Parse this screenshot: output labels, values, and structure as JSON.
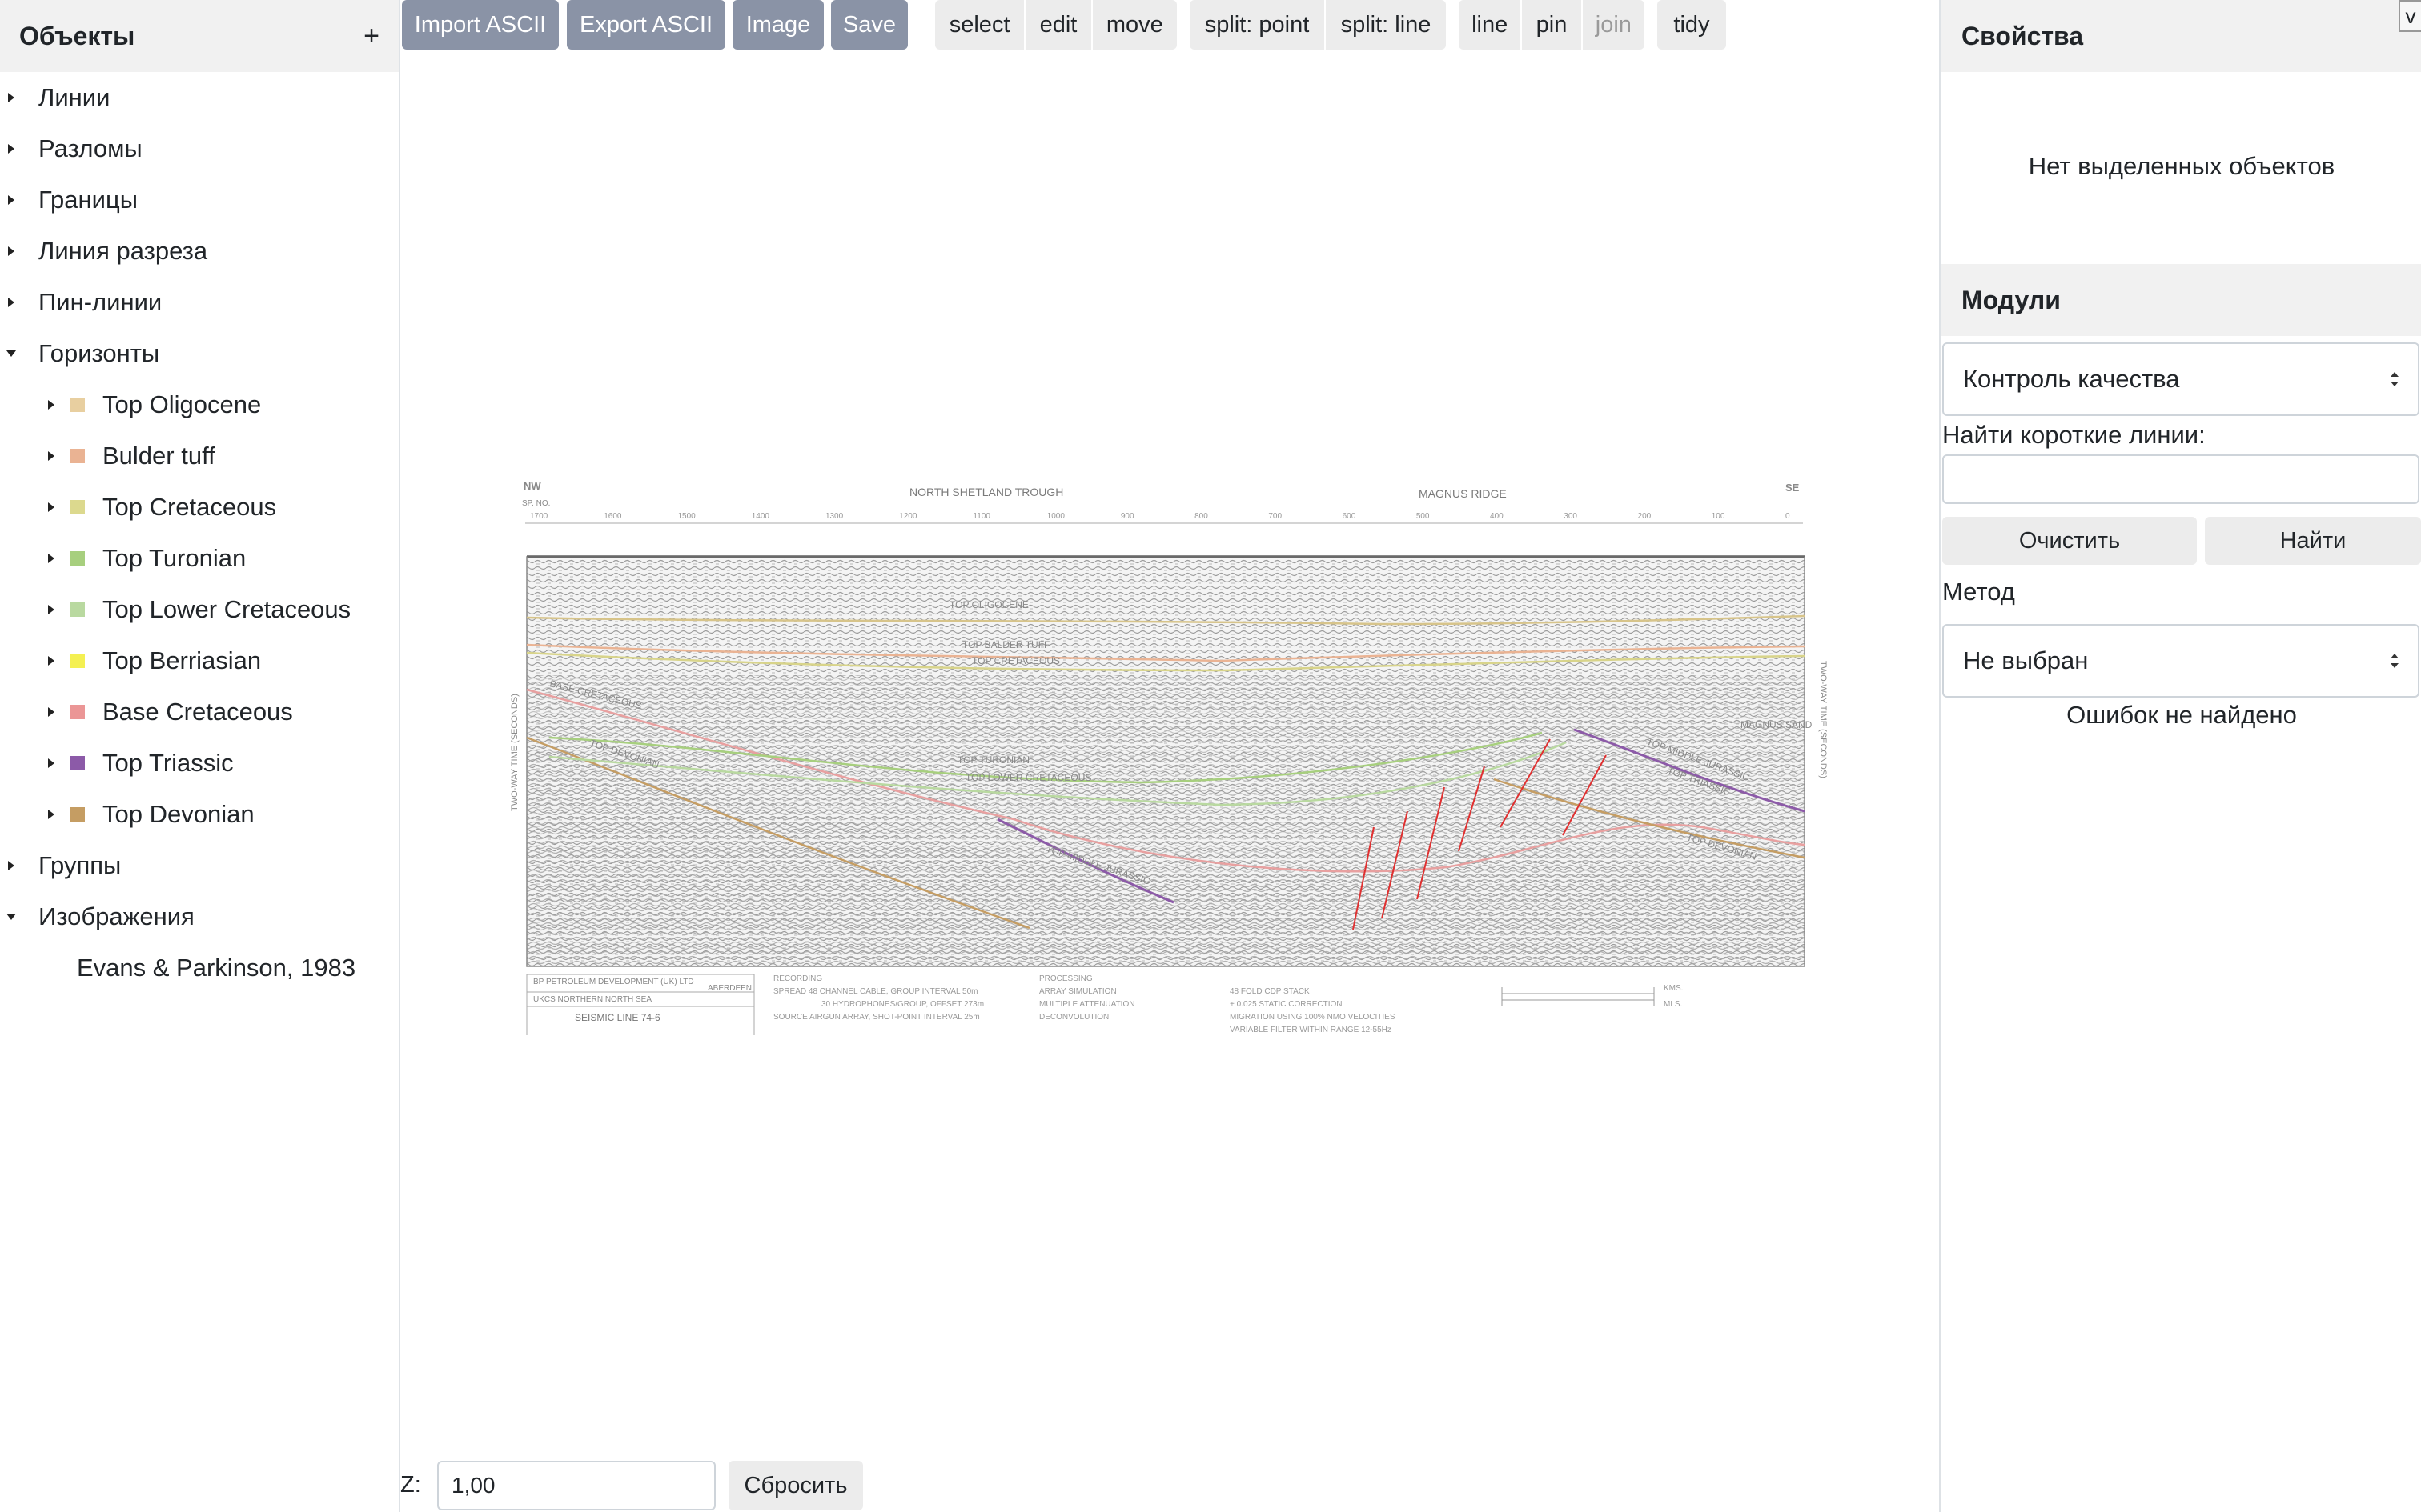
{
  "left_panel": {
    "title": "Объекты",
    "add_label": "+",
    "items": [
      {
        "label": "Линии"
      },
      {
        "label": "Разломы"
      },
      {
        "label": "Границы"
      },
      {
        "label": "Линия разреза"
      },
      {
        "label": "Пин-линии"
      },
      {
        "label": "Горизонты"
      },
      {
        "label": "Группы"
      },
      {
        "label": "Изображения"
      }
    ],
    "horizons": [
      {
        "label": "Top Oligocene",
        "color": "#e8cfa0"
      },
      {
        "label": "Bulder tuff",
        "color": "#eab393"
      },
      {
        "label": "Top Cretaceous",
        "color": "#dcd98e"
      },
      {
        "label": "Top Turonian",
        "color": "#a7cf7e"
      },
      {
        "label": "Top Lower Cretaceous",
        "color": "#b9d9a0"
      },
      {
        "label": "Top Berriasian",
        "color": "#f4f052"
      },
      {
        "label": "Base Cretaceous",
        "color": "#eb9696"
      },
      {
        "label": "Top Triassic",
        "color": "#8c5aa8"
      },
      {
        "label": "Top Devonian",
        "color": "#c59d63"
      }
    ],
    "images": [
      {
        "label": "Evans & Parkinson, 1983"
      }
    ]
  },
  "toolbar": {
    "import_label": "Import ASCII",
    "export_label": "Export ASCII",
    "image_label": "Image",
    "save_label": "Save",
    "mode_group": [
      "select",
      "edit",
      "move"
    ],
    "split_group": [
      "split: point",
      "split: line"
    ],
    "draw_group": [
      "line",
      "pin",
      "join"
    ],
    "tidy_label": "tidy"
  },
  "seismic": {
    "nw": "NW",
    "se": "SE",
    "sp_no": "SP. NO.",
    "trough": "NORTH SHETLAND  TROUGH",
    "ridge": "MAGNUS   RIDGE",
    "sp_ticks": [
      "1700",
      "1600",
      "1500",
      "1400",
      "1300",
      "1200",
      "1100",
      "1000",
      "900",
      "800",
      "700",
      "600",
      "500",
      "400",
      "300",
      "200",
      "100",
      "0"
    ],
    "time_label_left": "TWO-WAY TIME (SECONDS)",
    "time_label_right": "TWO-WAY TIME (SECONDS)",
    "horizon_labels": [
      "TOP OLIGOCENE",
      "TOP BALDER TUFF",
      "TOP CRETACEOUS",
      "BASE CRETACEOUS",
      "TOP DEVONIAN",
      "TOP TURONIAN",
      "TOP LOWER CRETACEOUS",
      "TOP MIDDLE JURASSIC",
      "MAGNUS SAND",
      "TOP MIDDLE JURASSIC",
      "TOP TRIASSIC",
      "TOP DEVONIAN"
    ],
    "company_1": "BP PETROLEUM DEVELOPMENT (UK) LTD",
    "company_2": "ABERDEEN",
    "ukcs": "UKCS   NORTHERN  NORTH  SEA",
    "line_name": "SEISMIC  LINE  74-6",
    "recording": "RECORDING",
    "spread": "SPREAD  48 CHANNEL CABLE, GROUP INTERVAL 50m",
    "hydro": "30 HYDROPHONES/GROUP, OFFSET 273m",
    "source": "SOURCE  AIRGUN ARRAY, SHOT-POINT INTERVAL 25m",
    "processing": "PROCESSING",
    "array_sim": "ARRAY SIMULATION",
    "mult_att": "MULTIPLE  ATTENUATION",
    "decon": "DECONVOLUTION",
    "cdp": "48 FOLD CDP STACK",
    "static": "+ 0.025  STATIC CORRECTION",
    "migration": "MIGRATION USING 100% NMO VELOCITIES",
    "filter": "VARIABLE FILTER WITHIN RANGE 12-55Hz",
    "kms": "KMS.",
    "mls": "MLS."
  },
  "bottom": {
    "z_label": "Z:",
    "z_value": "1,00",
    "reset_label": "Сбросить"
  },
  "right_panel": {
    "collapse_label": "v",
    "properties_title": "Свойства",
    "no_selection": "Нет выделенных объектов",
    "modules_title": "Модули",
    "module_select": "Контроль качества",
    "short_lines_label": "Найти короткие линии:",
    "short_lines_value": "",
    "clear_label": "Очистить",
    "find_label": "Найти",
    "method_label": "Метод",
    "method_select": "Не выбран",
    "status": "Ошибок не найдено"
  }
}
